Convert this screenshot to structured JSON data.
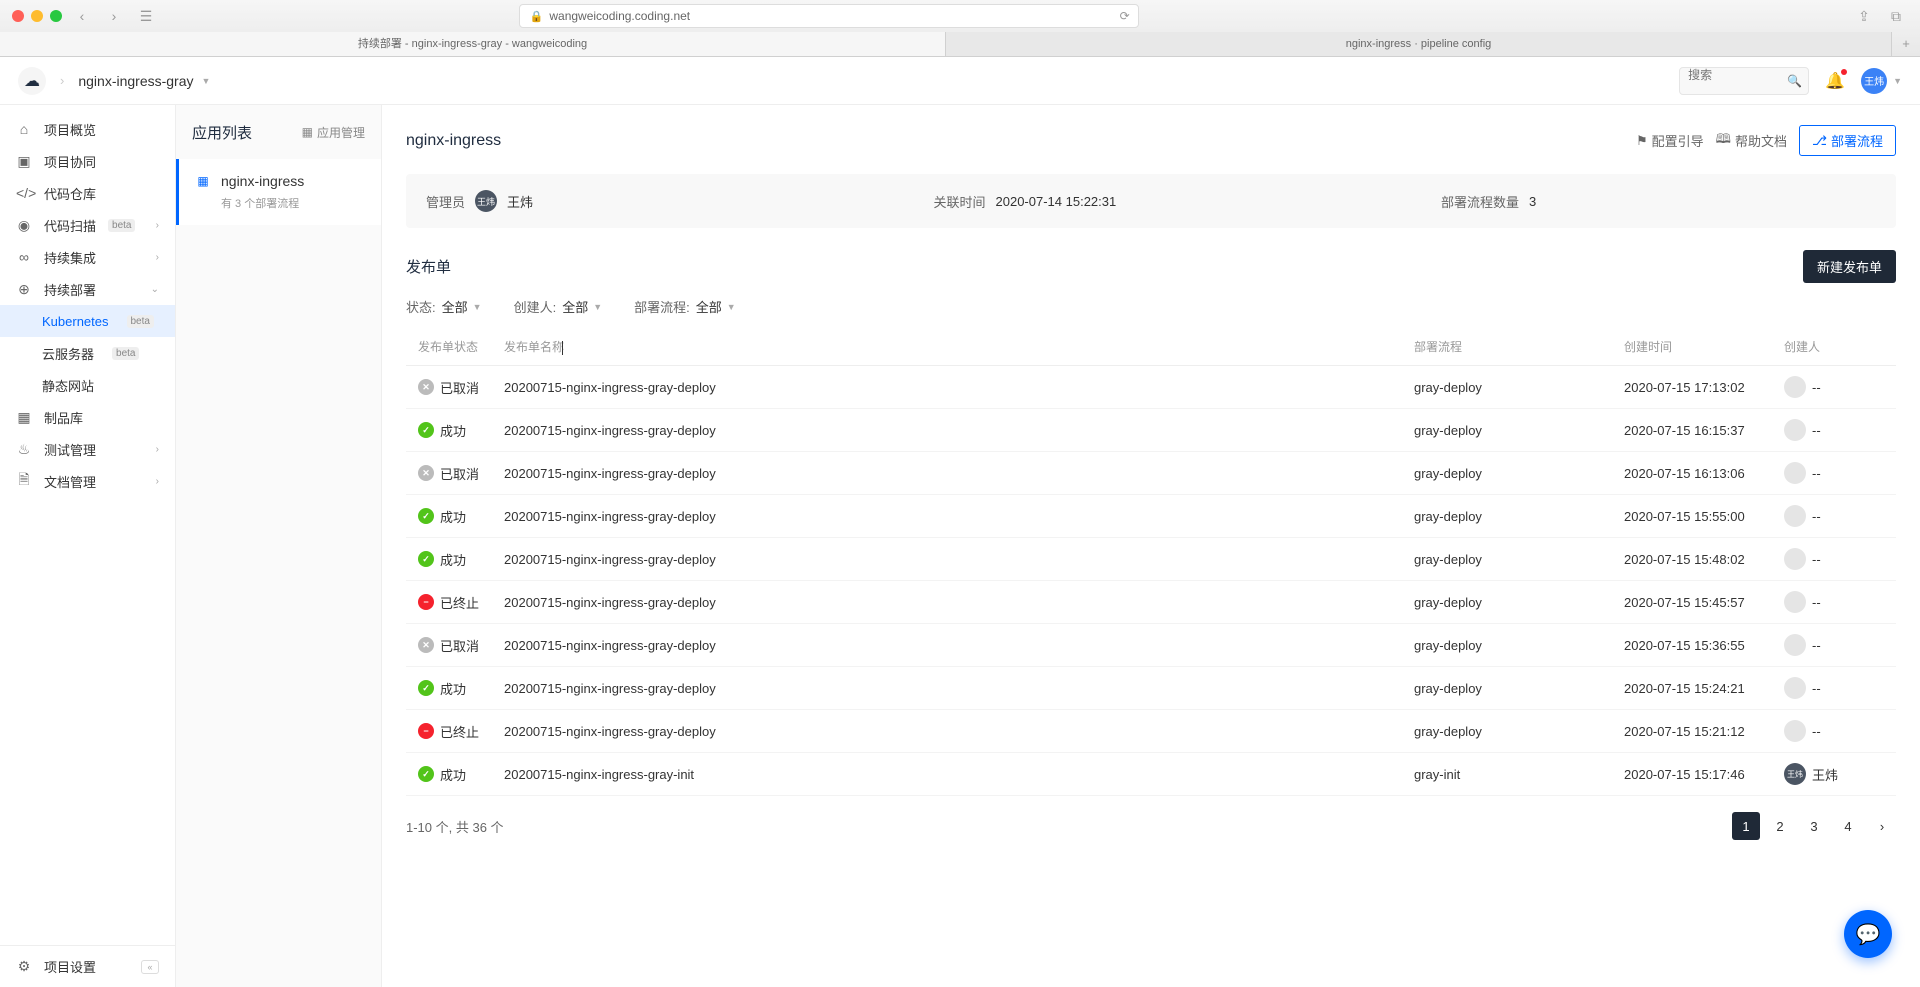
{
  "browser": {
    "url": "wangweicoding.coding.net",
    "tab1": "持续部署 - nginx-ingress-gray - wangweicoding",
    "tab2": "nginx-ingress · pipeline config"
  },
  "header": {
    "project": "nginx-ingress-gray",
    "search_placeholder": "搜索"
  },
  "sidebar": {
    "items": {
      "overview": "项目概览",
      "collab": "项目协同",
      "code": "代码仓库",
      "scan": "代码扫描",
      "ci": "持续集成",
      "cd": "持续部署",
      "k8s": "Kubernetes",
      "cloud": "云服务器",
      "static": "静态网站",
      "artifact": "制品库",
      "test": "测试管理",
      "doc": "文档管理"
    },
    "beta": "beta",
    "settings": "项目设置"
  },
  "applist": {
    "title": "应用列表",
    "manage": "应用管理",
    "app_name": "nginx-ingress",
    "app_sub": "有 3 个部署流程"
  },
  "page": {
    "title": "nginx-ingress",
    "config_guide": "配置引导",
    "help_doc": "帮助文档",
    "deploy_flow": "部署流程"
  },
  "info": {
    "admin_label": "管理员",
    "admin_name": "王炜",
    "link_time_label": "关联时间",
    "link_time": "2020-07-14 15:22:31",
    "flow_count_label": "部署流程数量",
    "flow_count": "3"
  },
  "release": {
    "title": "发布单",
    "new_btn": "新建发布单",
    "filter_status": "状态:",
    "filter_creator": "创建人:",
    "filter_flow": "部署流程:",
    "filter_all": "全部"
  },
  "table": {
    "cols": {
      "status": "发布单状态",
      "name": "发布单名称",
      "proc": "部署流程",
      "time": "创建时间",
      "creator": "创建人"
    },
    "rows": [
      {
        "status": "cancel",
        "status_text": "已取消",
        "name": "20200715-nginx-ingress-gray-deploy",
        "proc": "gray-deploy",
        "time": "2020-07-15 17:13:02",
        "creator": "--"
      },
      {
        "status": "success",
        "status_text": "成功",
        "name": "20200715-nginx-ingress-gray-deploy",
        "proc": "gray-deploy",
        "time": "2020-07-15 16:15:37",
        "creator": "--"
      },
      {
        "status": "cancel",
        "status_text": "已取消",
        "name": "20200715-nginx-ingress-gray-deploy",
        "proc": "gray-deploy",
        "time": "2020-07-15 16:13:06",
        "creator": "--"
      },
      {
        "status": "success",
        "status_text": "成功",
        "name": "20200715-nginx-ingress-gray-deploy",
        "proc": "gray-deploy",
        "time": "2020-07-15 15:55:00",
        "creator": "--"
      },
      {
        "status": "success",
        "status_text": "成功",
        "name": "20200715-nginx-ingress-gray-deploy",
        "proc": "gray-deploy",
        "time": "2020-07-15 15:48:02",
        "creator": "--"
      },
      {
        "status": "stop",
        "status_text": "已终止",
        "name": "20200715-nginx-ingress-gray-deploy",
        "proc": "gray-deploy",
        "time": "2020-07-15 15:45:57",
        "creator": "--"
      },
      {
        "status": "cancel",
        "status_text": "已取消",
        "name": "20200715-nginx-ingress-gray-deploy",
        "proc": "gray-deploy",
        "time": "2020-07-15 15:36:55",
        "creator": "--"
      },
      {
        "status": "success",
        "status_text": "成功",
        "name": "20200715-nginx-ingress-gray-deploy",
        "proc": "gray-deploy",
        "time": "2020-07-15 15:24:21",
        "creator": "--"
      },
      {
        "status": "stop",
        "status_text": "已终止",
        "name": "20200715-nginx-ingress-gray-deploy",
        "proc": "gray-deploy",
        "time": "2020-07-15 15:21:12",
        "creator": "--"
      },
      {
        "status": "success",
        "status_text": "成功",
        "name": "20200715-nginx-ingress-gray-init",
        "proc": "gray-init",
        "time": "2020-07-15 15:17:46",
        "creator": "王炜",
        "has_avatar": true
      }
    ]
  },
  "pagination": {
    "info": "1-10 个, 共 36 个",
    "pages": [
      "1",
      "2",
      "3",
      "4"
    ]
  },
  "user_initials": "王炜"
}
